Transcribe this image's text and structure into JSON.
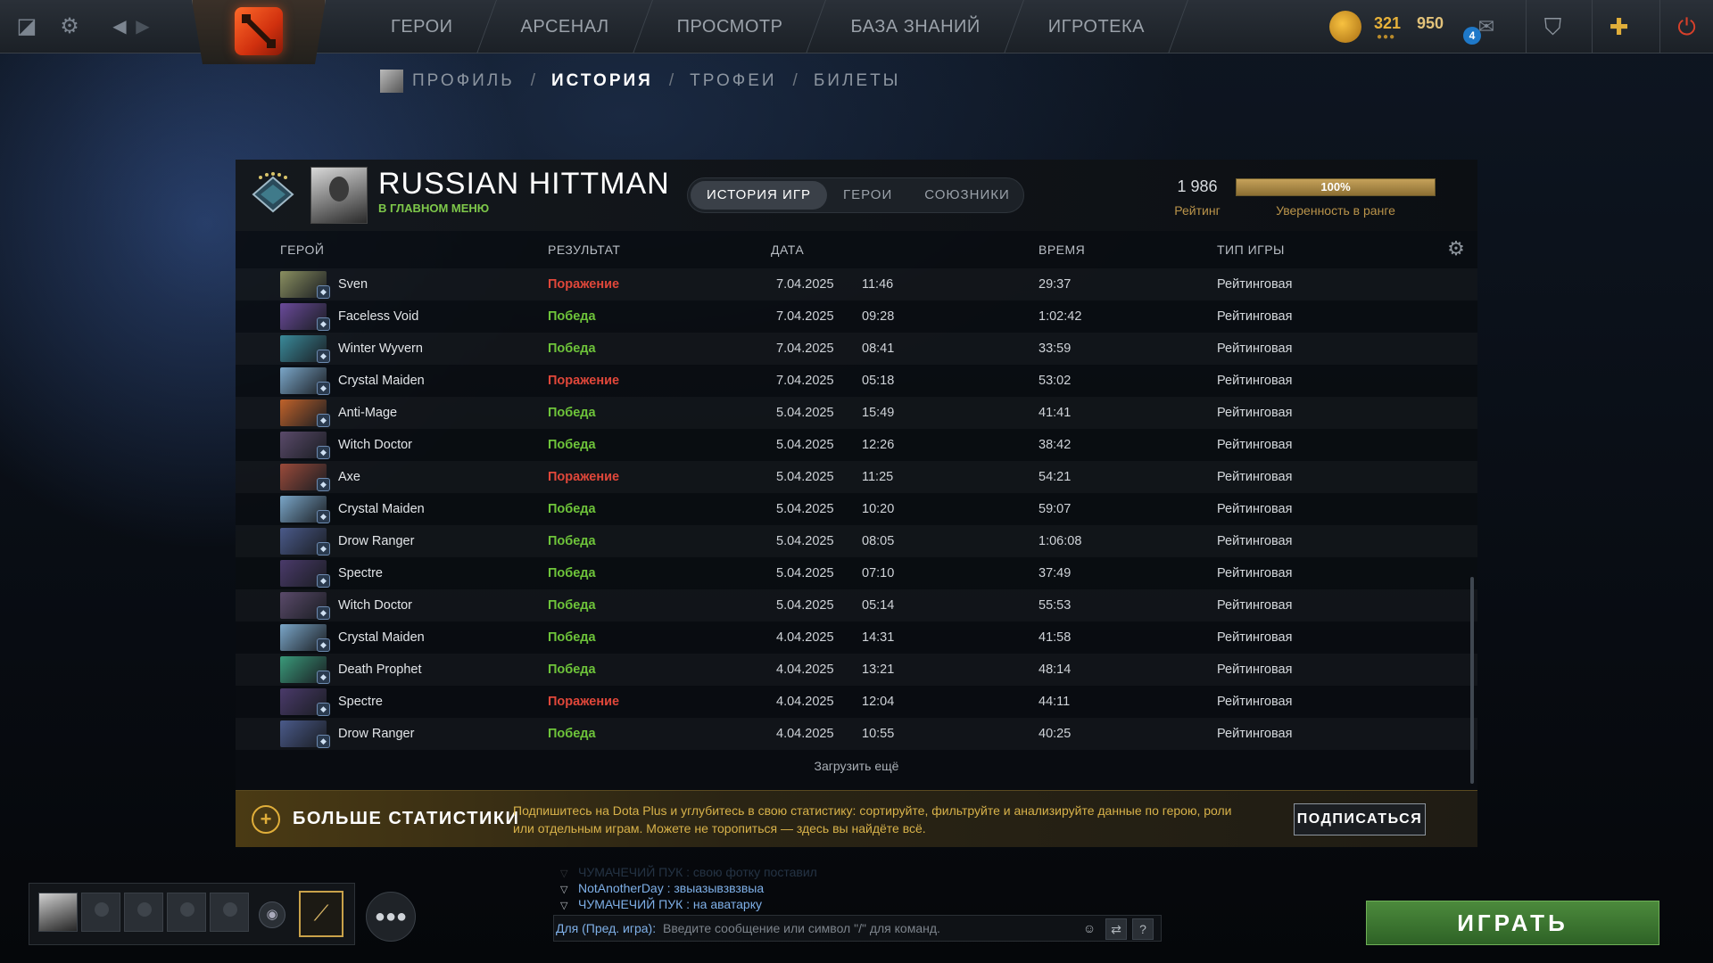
{
  "topbar": {
    "nav_items": [
      "ГЕРОИ",
      "АРСЕНАЛ",
      "ПРОСМОТР",
      "БАЗА ЗНАНИЙ",
      "ИГРОТЕКА"
    ],
    "shards": "321",
    "currency2": "950",
    "mail_count": "4"
  },
  "subnav": {
    "items": [
      "ПРОФИЛЬ",
      "ИСТОРИЯ",
      "ТРОФЕИ",
      "БИЛЕТЫ"
    ],
    "separator": "/",
    "active": "ИСТОРИЯ"
  },
  "profile": {
    "name": "RUSSIAN HITTMAN",
    "status": "В ГЛАВНОМ МЕНЮ",
    "rating_value": "1 986",
    "rating_label": "Рейтинг",
    "confidence": "100%",
    "confidence_fraction": 1.0,
    "confidence_label": "Уверенность в ранге"
  },
  "tabs": [
    "ИСТОРИЯ ИГР",
    "ГЕРОИ",
    "СОЮЗНИКИ"
  ],
  "columns": {
    "hero": "ГЕРОЙ",
    "result": "РЕЗУЛЬТАТ",
    "date": "ДАТА",
    "time": "ВРЕМЯ",
    "game_type": "ТИП ИГРЫ"
  },
  "matches": [
    {
      "hero": "Sven",
      "result": "Поражение",
      "win": false,
      "date": "7.04.2025",
      "clock": "11:46",
      "duration": "29:37",
      "type": "Рейтинговая",
      "color": "#8a8f60"
    },
    {
      "hero": "Faceless Void",
      "result": "Победа",
      "win": true,
      "date": "7.04.2025",
      "clock": "09:28",
      "duration": "1:02:42",
      "type": "Рейтинговая",
      "color": "#6a4a9a"
    },
    {
      "hero": "Winter Wyvern",
      "result": "Победа",
      "win": true,
      "date": "7.04.2025",
      "clock": "08:41",
      "duration": "33:59",
      "type": "Рейтинговая",
      "color": "#3a8a9a"
    },
    {
      "hero": "Crystal Maiden",
      "result": "Поражение",
      "win": false,
      "date": "7.04.2025",
      "clock": "05:18",
      "duration": "53:02",
      "type": "Рейтинговая",
      "color": "#7aa6c8"
    },
    {
      "hero": "Anti-Mage",
      "result": "Победа",
      "win": true,
      "date": "5.04.2025",
      "clock": "15:49",
      "duration": "41:41",
      "type": "Рейтинговая",
      "color": "#c0622a"
    },
    {
      "hero": "Witch Doctor",
      "result": "Победа",
      "win": true,
      "date": "5.04.2025",
      "clock": "12:26",
      "duration": "38:42",
      "type": "Рейтинговая",
      "color": "#5a4a6a"
    },
    {
      "hero": "Axe",
      "result": "Поражение",
      "win": false,
      "date": "5.04.2025",
      "clock": "11:25",
      "duration": "54:21",
      "type": "Рейтинговая",
      "color": "#9a4a3a"
    },
    {
      "hero": "Crystal Maiden",
      "result": "Победа",
      "win": true,
      "date": "5.04.2025",
      "clock": "10:20",
      "duration": "59:07",
      "type": "Рейтинговая",
      "color": "#7aa6c8"
    },
    {
      "hero": "Drow Ranger",
      "result": "Победа",
      "win": true,
      "date": "5.04.2025",
      "clock": "08:05",
      "duration": "1:06:08",
      "type": "Рейтинговая",
      "color": "#4a5a8a"
    },
    {
      "hero": "Spectre",
      "result": "Победа",
      "win": true,
      "date": "5.04.2025",
      "clock": "07:10",
      "duration": "37:49",
      "type": "Рейтинговая",
      "color": "#4a3a6a"
    },
    {
      "hero": "Witch Doctor",
      "result": "Победа",
      "win": true,
      "date": "5.04.2025",
      "clock": "05:14",
      "duration": "55:53",
      "type": "Рейтинговая",
      "color": "#5a4a6a"
    },
    {
      "hero": "Crystal Maiden",
      "result": "Победа",
      "win": true,
      "date": "4.04.2025",
      "clock": "14:31",
      "duration": "41:58",
      "type": "Рейтинговая",
      "color": "#7aa6c8"
    },
    {
      "hero": "Death Prophet",
      "result": "Победа",
      "win": true,
      "date": "4.04.2025",
      "clock": "13:21",
      "duration": "48:14",
      "type": "Рейтинговая",
      "color": "#3a9a7a"
    },
    {
      "hero": "Spectre",
      "result": "Поражение",
      "win": false,
      "date": "4.04.2025",
      "clock": "12:04",
      "duration": "44:11",
      "type": "Рейтинговая",
      "color": "#4a3a6a"
    },
    {
      "hero": "Drow Ranger",
      "result": "Победа",
      "win": true,
      "date": "4.04.2025",
      "clock": "10:55",
      "duration": "40:25",
      "type": "Рейтинговая",
      "color": "#4a5a8a"
    }
  ],
  "load_more": "Загрузить ещё",
  "promo": {
    "title": "БОЛЬШЕ СТАТИСТИКИ",
    "text": "Подпишитесь на Dota Plus и углубитесь в свою статистику: сортируйте, фильтруйте и анализируйте данные по герою, роли или отдельным играм. Можете не торопиться — здесь вы найдёте всё.",
    "button": "ПОДПИСАТЬСЯ"
  },
  "chat": {
    "lines": [
      {
        "user": "ЧУМАЧЕЧИЙ ПУК",
        "msg": " : свою фотку поставил",
        "faded": true
      },
      {
        "user": "NotAnotherDay",
        "msg": " : звыазывзвзвыа",
        "faded": false
      },
      {
        "user": "ЧУМАЧЕЧИЙ ПУК",
        "msg": " : на аватарку",
        "faded": false
      }
    ],
    "channel": "Для (Пред. игра):",
    "placeholder": "Введите сообщение или символ \"/\" для команд.",
    "help": "?"
  },
  "play_button": "ИГРАТЬ",
  "colors": {
    "win": "#6ec43a",
    "loss": "#e0473a",
    "accent_gold": "#c5a15a"
  }
}
